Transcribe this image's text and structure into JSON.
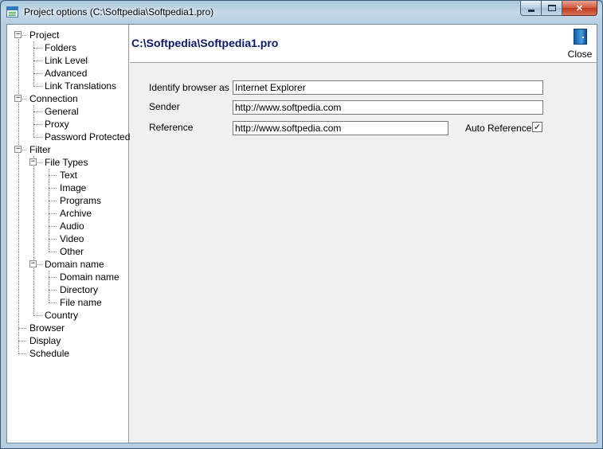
{
  "window": {
    "title": "Project options (C:\\Softpedia\\Softpedia1.pro)",
    "app_icon": "project-options-icon"
  },
  "tree": [
    {
      "label": "Project",
      "level": 0,
      "expanded": true
    },
    {
      "label": "Folders",
      "level": 1
    },
    {
      "label": "Link Level",
      "level": 1
    },
    {
      "label": "Advanced",
      "level": 1
    },
    {
      "label": "Link Translations",
      "level": 1
    },
    {
      "label": "Connection",
      "level": 0,
      "expanded": true
    },
    {
      "label": "General",
      "level": 1
    },
    {
      "label": "Proxy",
      "level": 1
    },
    {
      "label": "Password Protected",
      "level": 1
    },
    {
      "label": "Filter",
      "level": 0,
      "expanded": true
    },
    {
      "label": "File Types",
      "level": 1,
      "expanded": true
    },
    {
      "label": "Text",
      "level": 2
    },
    {
      "label": "Image",
      "level": 2
    },
    {
      "label": "Programs",
      "level": 2
    },
    {
      "label": "Archive",
      "level": 2
    },
    {
      "label": "Audio",
      "level": 2
    },
    {
      "label": "Video",
      "level": 2
    },
    {
      "label": "Other",
      "level": 2
    },
    {
      "label": "Domain name",
      "level": 1,
      "expanded": true
    },
    {
      "label": "Domain name",
      "level": 2
    },
    {
      "label": "Directory",
      "level": 2
    },
    {
      "label": "File name",
      "level": 2
    },
    {
      "label": "Country",
      "level": 1
    },
    {
      "label": "Browser",
      "level": 0
    },
    {
      "label": "Display",
      "level": 0
    },
    {
      "label": "Schedule",
      "level": 0
    }
  ],
  "header": {
    "path": "C:\\Softpedia\\Softpedia1.pro",
    "close_label": "Close",
    "close_icon": "door-icon"
  },
  "form": {
    "identify_label": "Identify browser as",
    "identify_value": "Internet Explorer",
    "sender_label": "Sender",
    "sender_value": "http://www.softpedia.com",
    "reference_label": "Reference",
    "reference_value": "http://www.softpedia.com",
    "auto_reference_label": "Auto Reference",
    "auto_reference_checked": true
  },
  "colors": {
    "path_title": "#0a1a66",
    "close_button": "#c0391f"
  }
}
